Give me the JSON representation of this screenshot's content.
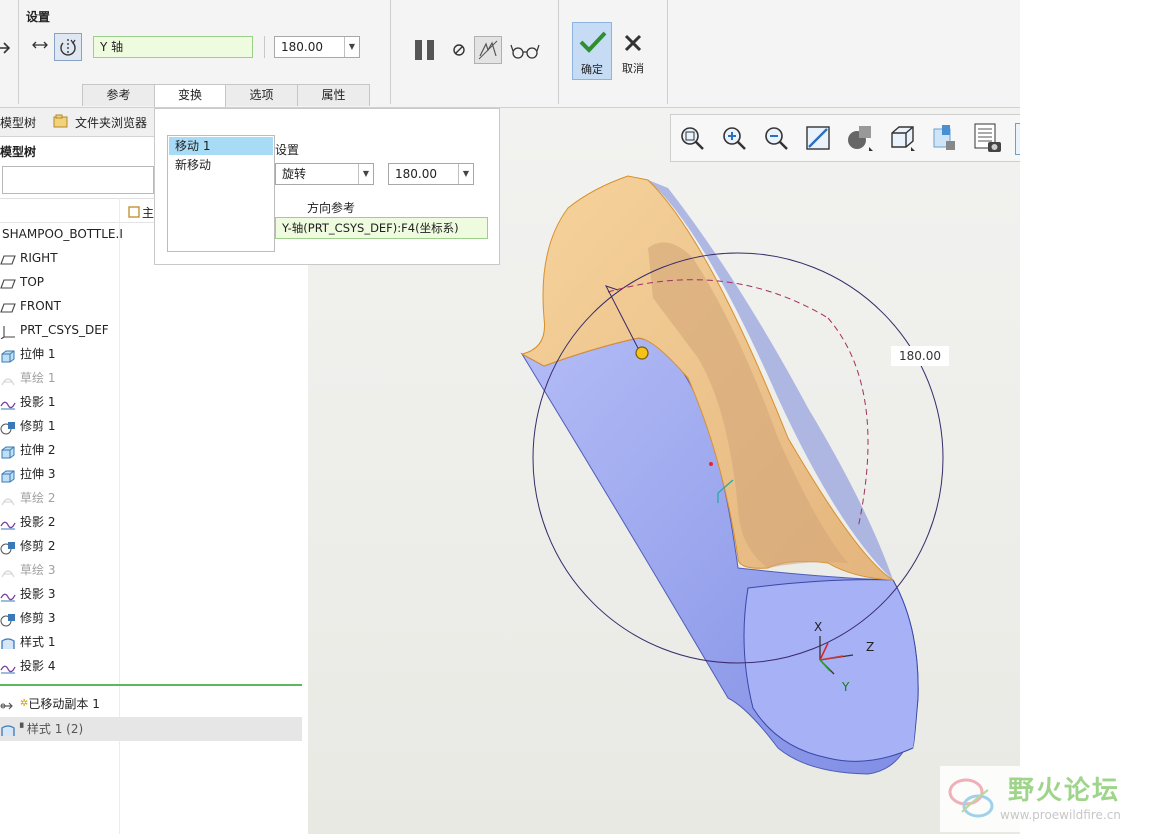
{
  "ribbon": {
    "section_label": "设置",
    "axis_field": "Y 轴",
    "angle_value": "180.00",
    "ok_label": "确定",
    "cancel_label": "取消",
    "tabs": [
      "参考",
      "变换",
      "选项",
      "属性"
    ]
  },
  "left_panel": {
    "tabs": [
      "模型树",
      "文件夹浏览器"
    ],
    "header": "模型树",
    "column_label": "主",
    "items": [
      {
        "label": "SHAMPOO_BOTTLE.I",
        "dim": false,
        "icon": "part-icon"
      },
      {
        "label": "RIGHT",
        "dim": false,
        "icon": "datum-plane-icon"
      },
      {
        "label": "TOP",
        "dim": false,
        "icon": "datum-plane-icon"
      },
      {
        "label": "FRONT",
        "dim": false,
        "icon": "datum-plane-icon"
      },
      {
        "label": "PRT_CSYS_DEF",
        "dim": false,
        "icon": "csys-icon"
      },
      {
        "label": "拉伸 1",
        "dim": false,
        "icon": "extrude-icon"
      },
      {
        "label": "草绘 1",
        "dim": true,
        "icon": "sketch-icon"
      },
      {
        "label": "投影 1",
        "dim": false,
        "icon": "project-icon"
      },
      {
        "label": "修剪 1",
        "dim": false,
        "icon": "trim-icon"
      },
      {
        "label": "拉伸 2",
        "dim": false,
        "icon": "extrude-icon"
      },
      {
        "label": "拉伸 3",
        "dim": false,
        "icon": "extrude-icon"
      },
      {
        "label": "草绘 2",
        "dim": true,
        "icon": "sketch-icon"
      },
      {
        "label": "投影 2",
        "dim": false,
        "icon": "project-icon"
      },
      {
        "label": "修剪 2",
        "dim": false,
        "icon": "trim-icon"
      },
      {
        "label": "草绘 3",
        "dim": true,
        "icon": "sketch-icon"
      },
      {
        "label": "投影 3",
        "dim": false,
        "icon": "project-icon"
      },
      {
        "label": "修剪 3",
        "dim": false,
        "icon": "trim-icon"
      },
      {
        "label": "样式 1",
        "dim": false,
        "icon": "style-icon"
      },
      {
        "label": "投影 4",
        "dim": false,
        "icon": "project-icon"
      }
    ],
    "after_items": [
      {
        "label": "已移动副本 1",
        "icon": "moved-copy-icon"
      },
      {
        "label": "样式 1 (2)",
        "icon": "style-icon"
      }
    ]
  },
  "popup": {
    "moves": [
      "移动 1",
      "新移动"
    ],
    "settings_label": "设置",
    "type_value": "旋转",
    "angle_value": "180.00",
    "direction_ref_label": "方向参考",
    "direction_ref_value": "Y-轴(PRT_CSYS_DEF):F4(坐标系)"
  },
  "viewport": {
    "angle_label": "180.00",
    "csys_labels": [
      "X",
      "Z",
      "Y"
    ],
    "toolbar_icons": [
      "zoom-window-icon",
      "zoom-in-icon",
      "zoom-out-icon",
      "refit-icon",
      "shading-icon",
      "view-cube-icon",
      "saved-views-icon",
      "layers-icon"
    ]
  },
  "watermark": {
    "title": "野火论坛",
    "url": "www.proewildfire.cn"
  },
  "colors": {
    "accent_blue": "#a9c6f0",
    "model_blue": "#9aa6ee",
    "model_orange": "#f3c98a",
    "green_field": "#eefbdf"
  }
}
